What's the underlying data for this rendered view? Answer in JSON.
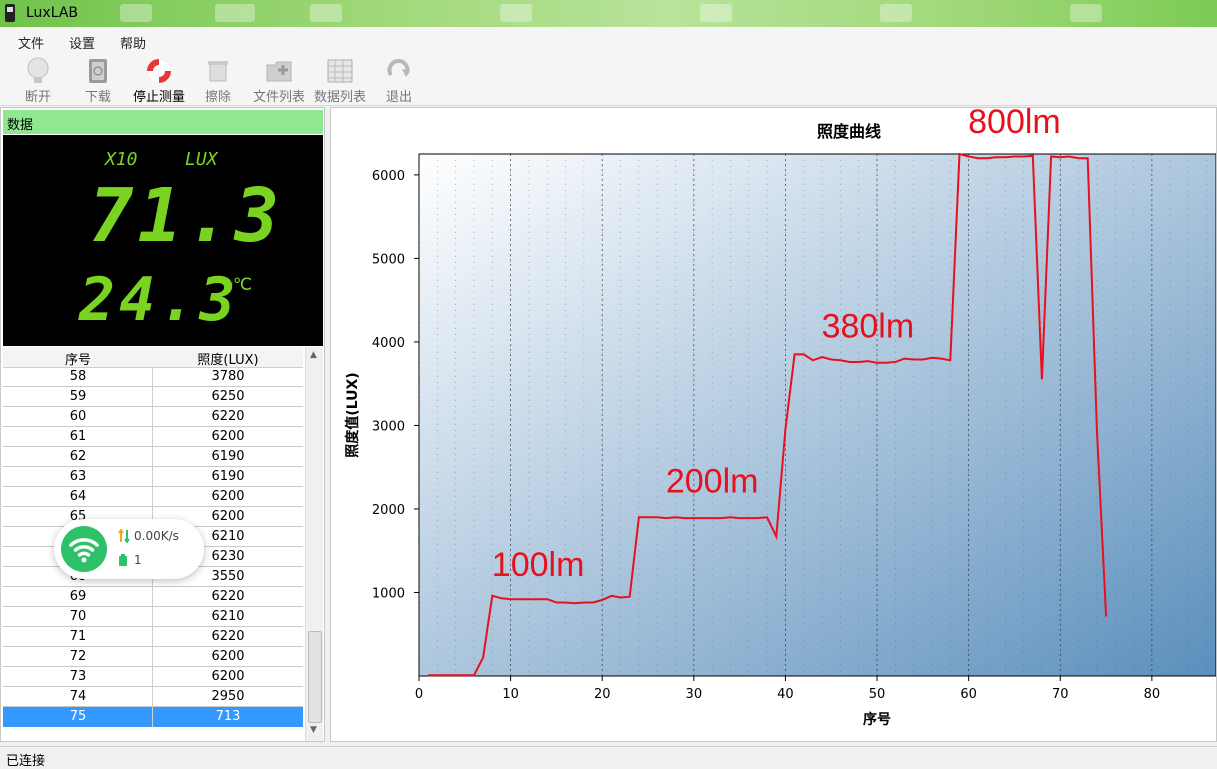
{
  "window": {
    "title": "LuxLAB"
  },
  "menu": [
    "文件",
    "设置",
    "帮助"
  ],
  "toolbar": [
    {
      "label": "断开",
      "icon": "bulb-icon",
      "enabled": false
    },
    {
      "label": "下载",
      "icon": "book-download-icon",
      "enabled": false
    },
    {
      "label": "停止测量",
      "icon": "lifebuoy-icon",
      "enabled": true
    },
    {
      "label": "擦除",
      "icon": "eraser-icon",
      "enabled": false
    },
    {
      "label": "文件列表",
      "icon": "folder-plus-icon",
      "enabled": false
    },
    {
      "label": "数据列表",
      "icon": "table-icon",
      "enabled": false
    },
    {
      "label": "退出",
      "icon": "exit-arrow-icon",
      "enabled": false
    }
  ],
  "left_panel": {
    "header": "数据",
    "display": {
      "multiplier": "X10",
      "unit": "LUX",
      "lux_value": "71.3",
      "temperature": "24.3",
      "temp_unit": "℃",
      "digit_color": "#7bd321"
    },
    "table": {
      "columns": [
        "序号",
        "照度(LUX)"
      ],
      "rows": [
        [
          "58",
          "3780"
        ],
        [
          "59",
          "6250"
        ],
        [
          "60",
          "6220"
        ],
        [
          "61",
          "6200"
        ],
        [
          "62",
          "6190"
        ],
        [
          "63",
          "6190"
        ],
        [
          "64",
          "6200"
        ],
        [
          "65",
          "6200"
        ],
        [
          "",
          "6210"
        ],
        [
          "",
          "6230"
        ],
        [
          "68",
          "3550"
        ],
        [
          "69",
          "6220"
        ],
        [
          "70",
          "6210"
        ],
        [
          "71",
          "6220"
        ],
        [
          "72",
          "6200"
        ],
        [
          "73",
          "6200"
        ],
        [
          "74",
          "2950"
        ],
        [
          "75",
          "713"
        ]
      ],
      "selected_row": 17
    }
  },
  "net_widget": {
    "speed": "0.00K/s",
    "count": "1"
  },
  "chart_data": {
    "type": "line",
    "title": "照度曲线",
    "xlabel": "序号",
    "ylabel": "照度值(LUX)",
    "xlim": [
      0,
      87
    ],
    "ylim": [
      0,
      6250
    ],
    "xticks": [
      0,
      10,
      20,
      30,
      40,
      50,
      60,
      70,
      80
    ],
    "yticks": [
      1000,
      2000,
      3000,
      4000,
      5000,
      6000
    ],
    "grid": true,
    "line_color": "#e8101c",
    "series": [
      {
        "x": [
          1,
          2,
          3,
          4,
          5,
          6,
          7,
          8,
          9,
          10,
          11,
          12,
          13,
          14,
          15,
          16,
          17,
          18,
          19,
          20,
          21,
          22,
          23,
          24,
          25,
          26,
          27,
          28,
          29,
          30,
          31,
          32,
          33,
          34,
          35,
          36,
          37,
          38,
          39,
          40,
          41,
          42,
          43,
          44,
          45,
          46,
          47,
          48,
          49,
          50,
          51,
          52,
          53,
          54,
          55,
          56,
          57,
          58,
          59,
          60,
          61,
          62,
          63,
          64,
          65,
          66,
          67,
          68,
          69,
          70,
          71,
          72,
          73,
          74,
          75
        ],
        "y": [
          10,
          10,
          10,
          10,
          10,
          10,
          220,
          960,
          930,
          920,
          920,
          920,
          920,
          920,
          880,
          880,
          870,
          880,
          880,
          910,
          960,
          940,
          950,
          1900,
          1900,
          1900,
          1890,
          1900,
          1890,
          1890,
          1890,
          1890,
          1890,
          1900,
          1890,
          1890,
          1890,
          1900,
          1670,
          2950,
          3850,
          3850,
          3780,
          3820,
          3790,
          3780,
          3760,
          3760,
          3770,
          3750,
          3750,
          3760,
          3800,
          3790,
          3790,
          3810,
          3800,
          3780,
          6250,
          6220,
          6200,
          6200,
          6210,
          6210,
          6220,
          6220,
          6230,
          3550,
          6220,
          6210,
          6220,
          6200,
          6200,
          2950,
          713
        ]
      }
    ],
    "annotations": [
      {
        "text": "100lm",
        "x": 13,
        "y": 1200
      },
      {
        "text": "200lm",
        "x": 32,
        "y": 2200
      },
      {
        "text": "380lm",
        "x": 49,
        "y": 4050
      },
      {
        "text": "800lm",
        "x": 65,
        "y": 6500
      }
    ],
    "annotation_color": "#e8101c",
    "bg_gradient": [
      "#ffffff",
      "#5b8fbd"
    ]
  },
  "status": {
    "text": "已连接"
  }
}
